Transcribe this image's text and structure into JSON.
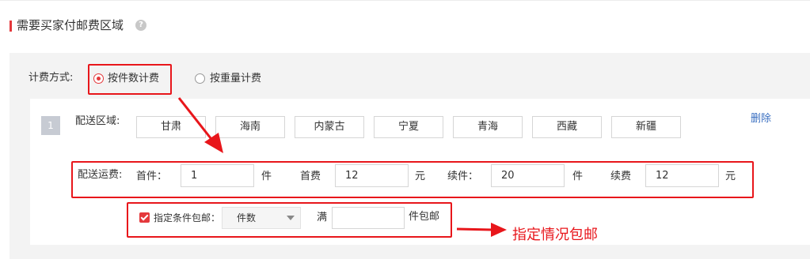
{
  "section": {
    "title": "需要买家付邮费区域",
    "help_glyph": "?"
  },
  "billing": {
    "label": "计费方式:",
    "options": [
      {
        "label": "按件数计费",
        "selected": true
      },
      {
        "label": "按重量计费",
        "selected": false
      }
    ]
  },
  "rule": {
    "index": "1",
    "region_label": "配送区域:",
    "regions": [
      "甘肃",
      "海南",
      "内蒙古",
      "宁夏",
      "青海",
      "西藏",
      "新疆"
    ],
    "delete_label": "删除",
    "fee": {
      "label": "配送运费:",
      "first_item_label": "首件：",
      "first_item_value": "1",
      "first_item_unit": "件",
      "first_fee_label": "首费",
      "first_fee_value": "12",
      "first_fee_unit": "元",
      "extra_item_label": "续件：",
      "extra_item_value": "20",
      "extra_item_unit": "件",
      "extra_fee_label": "续费",
      "extra_fee_value": "12",
      "extra_fee_unit": "元"
    },
    "free_shipping": {
      "checked": true,
      "label": "指定条件包邮：",
      "condition_selected": "件数",
      "full_label": "满",
      "value": "",
      "suffix": "件包邮"
    }
  },
  "annotation": {
    "text": "指定情况包邮",
    "color": "#e8161b"
  },
  "colors": {
    "accent": "#e4393c",
    "link": "#3a6fc1",
    "panel_bg": "#f3f3f3"
  }
}
